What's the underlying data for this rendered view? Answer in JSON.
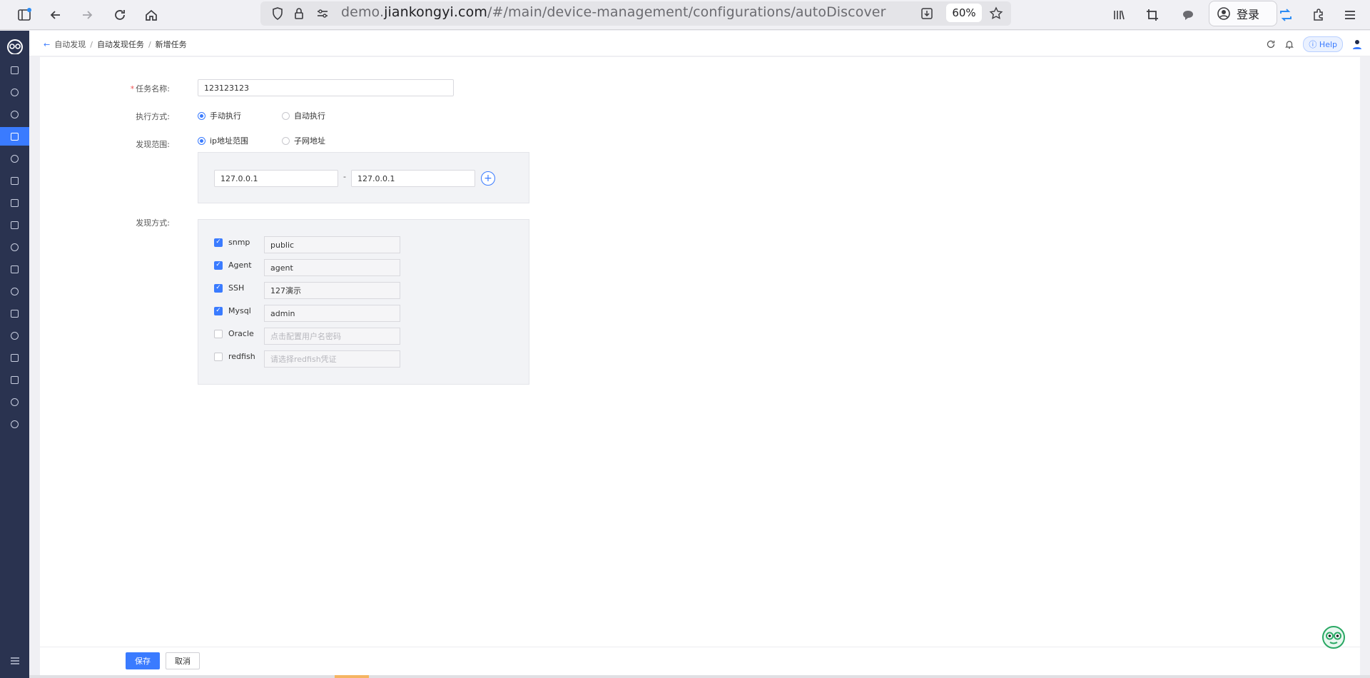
{
  "browser": {
    "url_prefix": "demo.",
    "url_host": "jiankongyi.com",
    "url_path": "/#/main/device-management/configurations/autoDiscover",
    "zoom": "60%",
    "login_label": "登录"
  },
  "header": {
    "breadcrumb": [
      "自动发现",
      "自动发现任务",
      "新增任务"
    ],
    "help_label": "Help"
  },
  "sidebar": {
    "items": [
      "dashboard-icon",
      "clock-icon",
      "bell-icon",
      "devices-icon",
      "alarm-icon",
      "chart-icon",
      "topology-icon",
      "list-icon",
      "globe-icon",
      "document-icon",
      "monitor-icon",
      "screen-icon",
      "network-icon",
      "report-icon",
      "stats-icon",
      "cloud-icon",
      "settings-icon"
    ],
    "active_index": 3,
    "collapse_icon": "menu-collapse-icon"
  },
  "form": {
    "task_name_label": "任务名称:",
    "task_name_value": "123123123",
    "exec_mode_label": "执行方式:",
    "exec_options": [
      "手动执行",
      "自动执行"
    ],
    "exec_selected": 0,
    "scope_label": "发现范围:",
    "scope_options": [
      "ip地址范围",
      "子网地址"
    ],
    "scope_selected": 0,
    "ip_start": "127.0.0.1",
    "ip_dash": "-",
    "ip_end": "127.0.0.1",
    "method_label": "发现方式:",
    "methods": [
      {
        "name": "snmp",
        "checked": true,
        "value": "public",
        "placeholder": false
      },
      {
        "name": "Agent",
        "checked": true,
        "value": "agent",
        "placeholder": false
      },
      {
        "name": "SSH",
        "checked": true,
        "value": "127演示",
        "placeholder": false
      },
      {
        "name": "Mysql",
        "checked": true,
        "value": "admin",
        "placeholder": false
      },
      {
        "name": "Oracle",
        "checked": false,
        "value": "点击配置用户名密码",
        "placeholder": true
      },
      {
        "name": "redfish",
        "checked": false,
        "value": "请选择redfish凭证",
        "placeholder": true
      }
    ]
  },
  "footer": {
    "save_label": "保存",
    "cancel_label": "取消"
  },
  "colors": {
    "accent": "#3a7bff",
    "sidebar_bg": "#2a3350"
  }
}
